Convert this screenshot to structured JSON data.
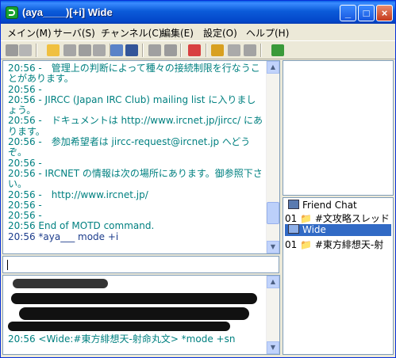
{
  "window": {
    "title": "(aya____)[+i] Wide"
  },
  "titlebar_buttons": {
    "minimize": "_",
    "maximize": "□",
    "close": "×"
  },
  "menu": [
    "メイン(M)",
    "サーバ(S)",
    "チャンネル(C)",
    "編集(E)",
    "設定(O)",
    "ヘルプ(H)"
  ],
  "main_log": [
    {
      "text": "20:56 -　管理上の判断によって種々の接続制限を行なうことがあります。",
      "color": "teal"
    },
    {
      "text": "20:56 -",
      "color": "teal"
    },
    {
      "text": "20:56 - JIRCC (Japan IRC Club) mailing list に入りましょう。",
      "color": "teal"
    },
    {
      "text": "20:56 -　ドキュメントは http://www.ircnet.jp/jircc/ にあります。",
      "color": "teal"
    },
    {
      "text": "20:56 -　参加希望者は jircc-request@ircnet.jp へどうぞ。",
      "color": "teal"
    },
    {
      "text": "20:56 -",
      "color": "teal"
    },
    {
      "text": "20:56 - IRCNET の情報は次の場所にあります。御参照下さい。",
      "color": "teal"
    },
    {
      "text": "20:56 -　http://www.ircnet.jp/",
      "color": "teal"
    },
    {
      "text": "20:56 -",
      "color": "teal"
    },
    {
      "text": "20:56 -",
      "color": "teal"
    },
    {
      "text": "20:56 End of MOTD command.",
      "color": "teal"
    },
    {
      "text": "20:56 *aya___ mode +i",
      "color": "blue"
    }
  ],
  "channels": [
    {
      "label": "Friend Chat",
      "kind": "server"
    },
    {
      "label": "01 📁 #文攻略スレッド",
      "kind": "channel"
    },
    {
      "label": "Wide",
      "kind": "server",
      "selected": true
    },
    {
      "label": "01 📁 #東方緋想天-射",
      "kind": "channel"
    }
  ],
  "bottom_log": [
    {
      "text": "20:56 <Wide:#東方緋想天-射命丸文> *mode +sn"
    }
  ],
  "colors": {
    "teal": "#008080",
    "blue": "#1c3c8c",
    "selection": "#316ac5"
  }
}
